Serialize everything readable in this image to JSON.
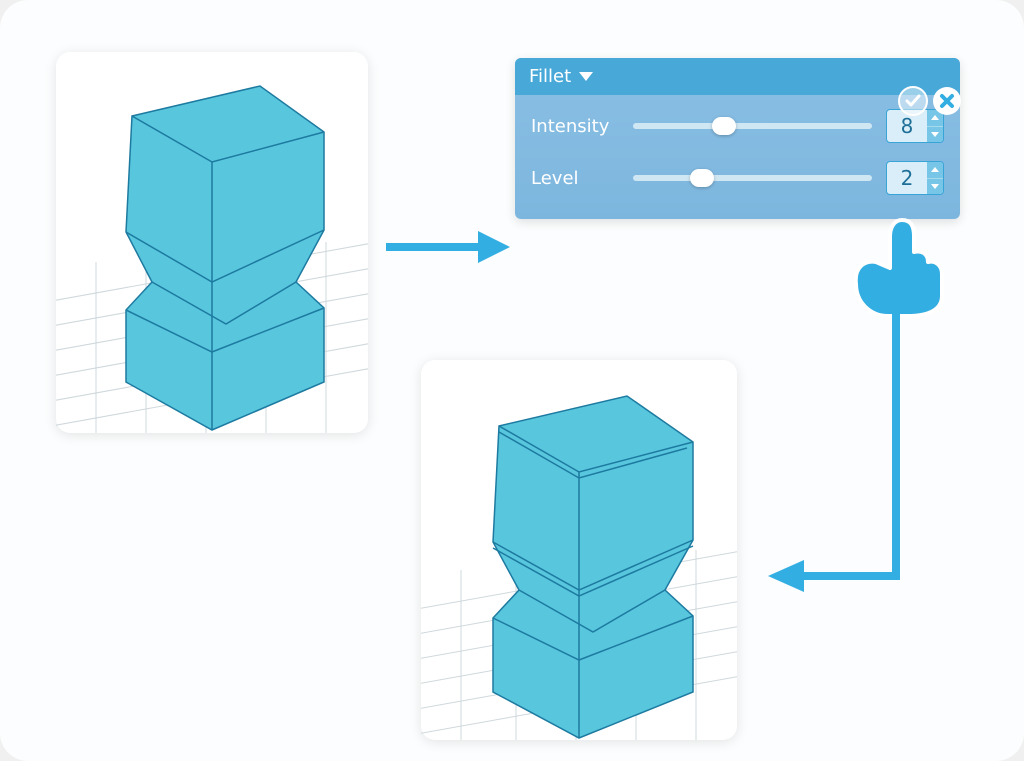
{
  "panel": {
    "title": "Fillet",
    "confirm_icon": "checkmark",
    "close_icon": "close",
    "params": [
      {
        "label": "Intensity",
        "value": "8",
        "knob_pct": 33
      },
      {
        "label": "Level",
        "value": "2",
        "knob_pct": 24
      }
    ]
  },
  "flow": {
    "step1_desc": "3D model preview (before)",
    "step2_desc": "3D model preview (after)"
  },
  "colors": {
    "accent": "#33aee2",
    "panel_header": "#48a8d8",
    "panel_body": "#7cb6de",
    "value_text": "#1e6f98"
  }
}
